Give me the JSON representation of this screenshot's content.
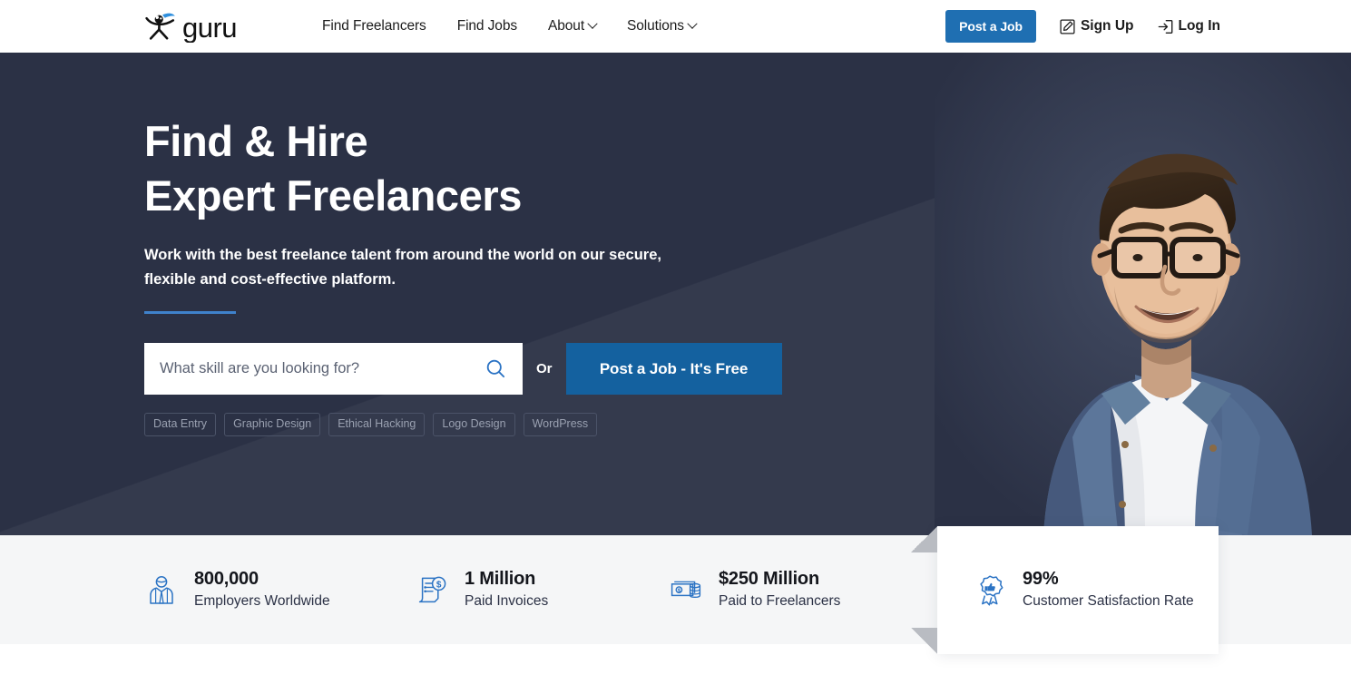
{
  "header": {
    "logo_text": "guru",
    "logo_icon": "guru-stickman-logo",
    "nav": [
      {
        "label": "Find Freelancers",
        "has_chevron": false
      },
      {
        "label": "Find Jobs",
        "has_chevron": false
      },
      {
        "label": "About",
        "has_chevron": true
      },
      {
        "label": "Solutions",
        "has_chevron": true
      }
    ],
    "post_job_label": "Post a Job",
    "sign_up_label": "Sign Up",
    "sign_up_icon": "pencil-edit-icon",
    "log_in_label": "Log In",
    "log_in_icon": "sign-in-arrow-icon"
  },
  "hero": {
    "title_line1": "Find & Hire",
    "title_line2": "Expert Freelancers",
    "subtitle": "Work with the best freelance talent from around the world on our secure, flexible and cost-effective platform.",
    "search_placeholder": "What skill are you looking for?",
    "search_value": "",
    "search_icon": "magnifier-icon",
    "or_label": "Or",
    "cta_label": "Post a Job - It's Free",
    "tags": [
      "Data Entry",
      "Graphic Design",
      "Ethical Hacking",
      "Logo Design",
      "WordPress"
    ],
    "photo_alt": "smiling man with glasses in denim shirt"
  },
  "stats": [
    {
      "value": "800,000",
      "label": "Employers Worldwide",
      "icon": "employer-person-icon"
    },
    {
      "value": "1 Million",
      "label": "Paid Invoices",
      "icon": "invoice-dollar-icon"
    },
    {
      "value": "$250 Million",
      "label": "Paid to Freelancers",
      "icon": "cash-money-icon"
    }
  ],
  "float_card": {
    "value": "99%",
    "label": "Customer Satisfaction Rate",
    "icon": "ribbon-thumbs-up-icon"
  },
  "colors": {
    "brand_blue": "#1f6fb2",
    "cta_blue": "#14619f",
    "hero_dark": "#2b3145",
    "hero_light": "#3a4255",
    "accent_rule": "#3f82cc",
    "stats_bg": "#f5f6f7",
    "icon_blue": "#2b73c4"
  }
}
